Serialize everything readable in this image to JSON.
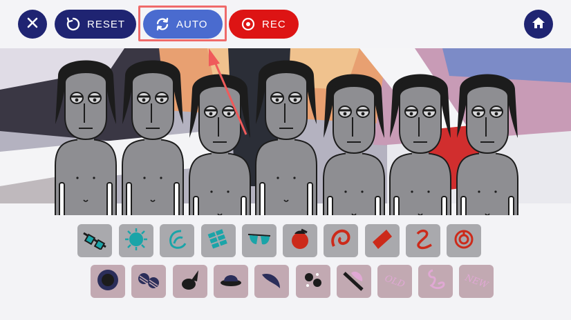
{
  "toolbar": {
    "close_icon": "close-icon",
    "reset_label": "RESET",
    "reset_icon": "reset-icon",
    "auto_label": "AUTO",
    "auto_icon": "refresh-icon",
    "rec_label": "REC",
    "rec_icon": "record-icon",
    "home_icon": "home-icon"
  },
  "colors": {
    "navy": "#1f2472",
    "auto_blue": "#4a6bcf",
    "rec_red": "#dd1414",
    "highlight": "#ef6a6a",
    "row1_tile": "#a9a9ad",
    "row2_tile": "#c2a9b2",
    "teal": "#1aa4a8"
  },
  "stage": {
    "character_count": 7
  },
  "palette": {
    "row1": [
      "teal-glasses-icon",
      "teal-sun-icon",
      "teal-swirl-icon",
      "teal-grid-icon",
      "teal-sunglasses-icon",
      "red-apple-icon",
      "red-spiral-icon",
      "red-diamond-icon",
      "red-squiggle-icon",
      "red-ring-icon"
    ],
    "row2": [
      "black-disc-icon",
      "striped-glasses-icon",
      "black-hat-icon",
      "black-bowler-icon",
      "black-wing-icon",
      "black-dots-icon",
      "pink-feathered-hat-icon",
      "pink-old-icon",
      "pink-flamingo-icon",
      "pink-new-icon"
    ],
    "row2_text": {
      "old": "OLD",
      "new": "NEW"
    }
  }
}
